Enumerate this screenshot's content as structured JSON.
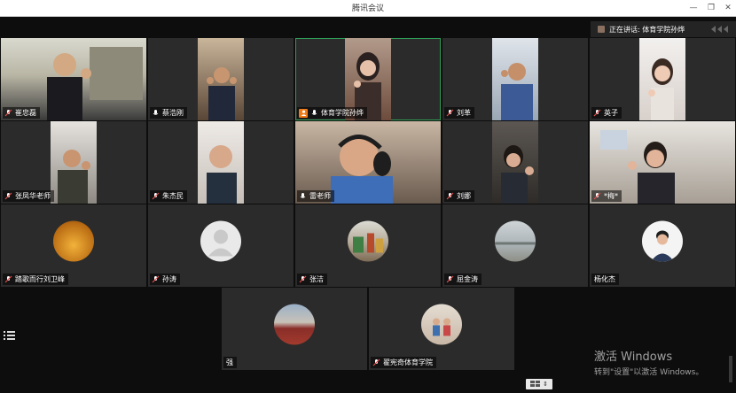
{
  "window": {
    "title": "腾讯会议"
  },
  "speaking": {
    "text": "正在讲话: 体育学院孙烨"
  },
  "participants": [
    {
      "name": "崔忠磊"
    },
    {
      "name": "蔡浩刚"
    },
    {
      "name": "体育学院孙烨"
    },
    {
      "name": "刘革"
    },
    {
      "name": "英子"
    },
    {
      "name": "张凤华老师"
    },
    {
      "name": "朱杰民"
    },
    {
      "name": "雷老师"
    },
    {
      "name": "刘娜"
    },
    {
      "name": "*梅*"
    },
    {
      "name": "踏歌而行刘卫峰"
    },
    {
      "name": "孙涛"
    },
    {
      "name": "张洁"
    },
    {
      "name": "屈金涛"
    },
    {
      "name": "杨化杰"
    },
    {
      "name": "强"
    },
    {
      "name": "翟宪奇体育学院"
    }
  ],
  "watermark": {
    "line1": "激活 Windows",
    "line2": "转到\"设置\"以激活 Windows。"
  },
  "icons": {
    "list": "list-icon",
    "mic_muted": "mic-muted-icon",
    "mic": "mic-icon",
    "host": "host-icon"
  },
  "colors": {
    "active_border": "#2f9e57",
    "host_badge": "#f07a18",
    "tile_bg": "#2b2b2b"
  }
}
